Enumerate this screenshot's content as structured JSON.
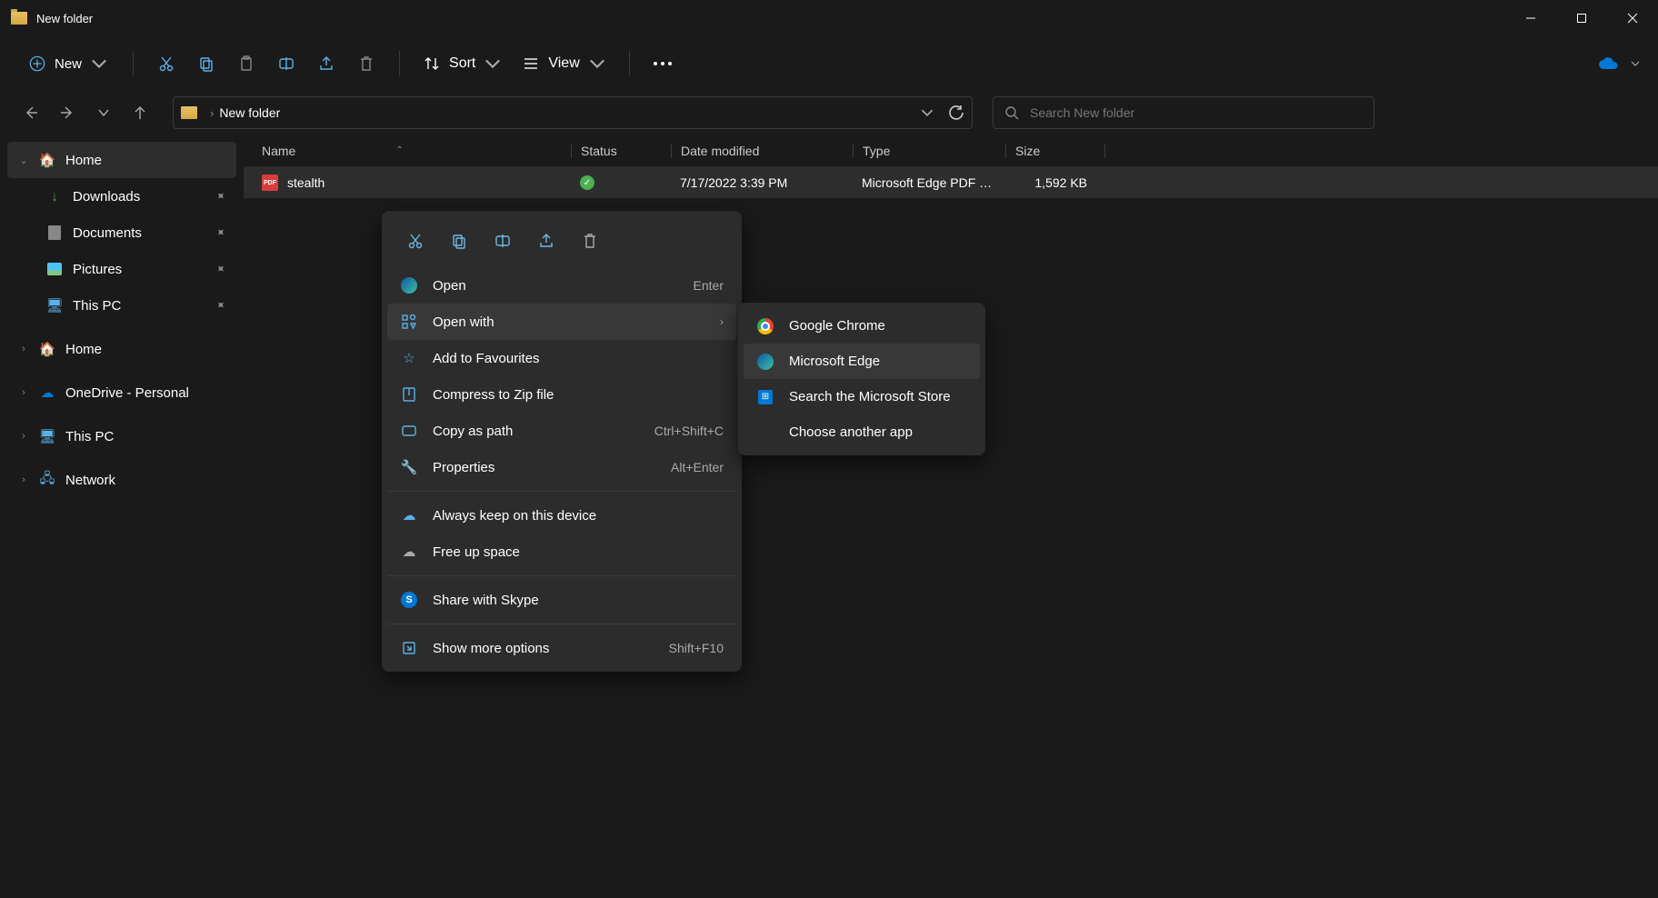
{
  "window": {
    "title": "New folder"
  },
  "toolbar": {
    "new": "New",
    "sort": "Sort",
    "view": "View"
  },
  "breadcrumb": {
    "current": "New folder"
  },
  "search": {
    "placeholder": "Search New folder"
  },
  "sidebar": {
    "home": "Home",
    "downloads": "Downloads",
    "documents": "Documents",
    "pictures": "Pictures",
    "thispc_pinned": "This PC",
    "home2": "Home",
    "onedrive": "OneDrive - Personal",
    "thispc": "This PC",
    "network": "Network"
  },
  "columns": {
    "name": "Name",
    "status": "Status",
    "date": "Date modified",
    "type": "Type",
    "size": "Size"
  },
  "files": [
    {
      "name": "stealth",
      "date": "7/17/2022 3:39 PM",
      "type": "Microsoft Edge PDF …",
      "size": "1,592 KB"
    }
  ],
  "context_menu": {
    "open": "Open",
    "open_shortcut": "Enter",
    "open_with": "Open with",
    "favourites": "Add to Favourites",
    "compress": "Compress to Zip file",
    "copy_path": "Copy as path",
    "copy_path_shortcut": "Ctrl+Shift+C",
    "properties": "Properties",
    "properties_shortcut": "Alt+Enter",
    "always_keep": "Always keep on this device",
    "free_up": "Free up space",
    "skype": "Share with Skype",
    "more": "Show more options",
    "more_shortcut": "Shift+F10"
  },
  "submenu": {
    "chrome": "Google Chrome",
    "edge": "Microsoft Edge",
    "store": "Search the Microsoft Store",
    "another": "Choose another app"
  }
}
